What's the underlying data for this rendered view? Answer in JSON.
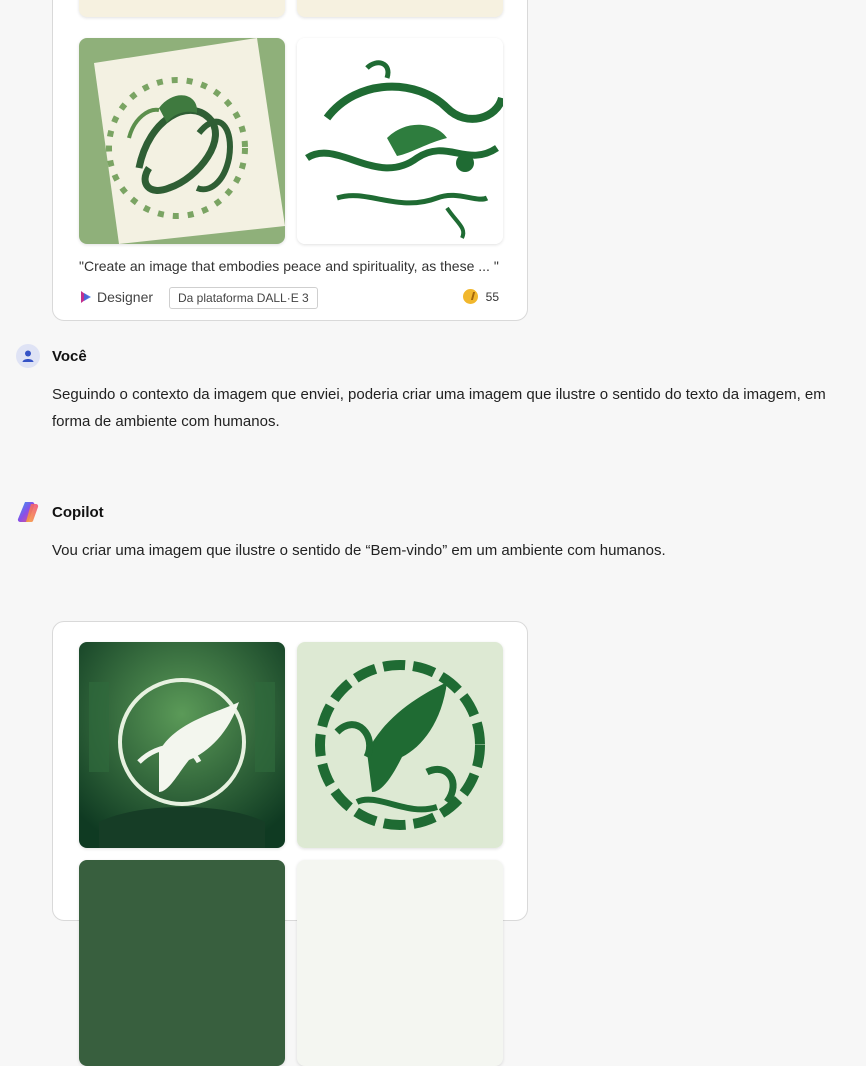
{
  "first_card": {
    "caption": "\"Create an image that embodies peace and spirituality, as these ... \"",
    "source_name": "Designer",
    "platform_tag": "Da plataforma DALL·E 3",
    "boost_count": "55",
    "images": [
      {
        "description_icon": "calligraphy-dove-image"
      },
      {
        "description_icon": "calligraphy-dove-image"
      }
    ]
  },
  "user_message": {
    "author": "Você",
    "text": "Seguindo o contexto da imagem que enviei, poderia criar uma imagem que ilustre o sentido do texto da imagem, em forma de ambiente com humanos."
  },
  "copilot_message": {
    "author": "Copilot",
    "text": "Vou criar uma imagem que ilustre o sentido de “Bem-vindo” em um ambiente com humanos."
  },
  "colors": {
    "background": "#f7f7f7",
    "card_border": "#d9d9d9",
    "green_dark": "#1f6b33",
    "green_light": "#dde9d3"
  }
}
